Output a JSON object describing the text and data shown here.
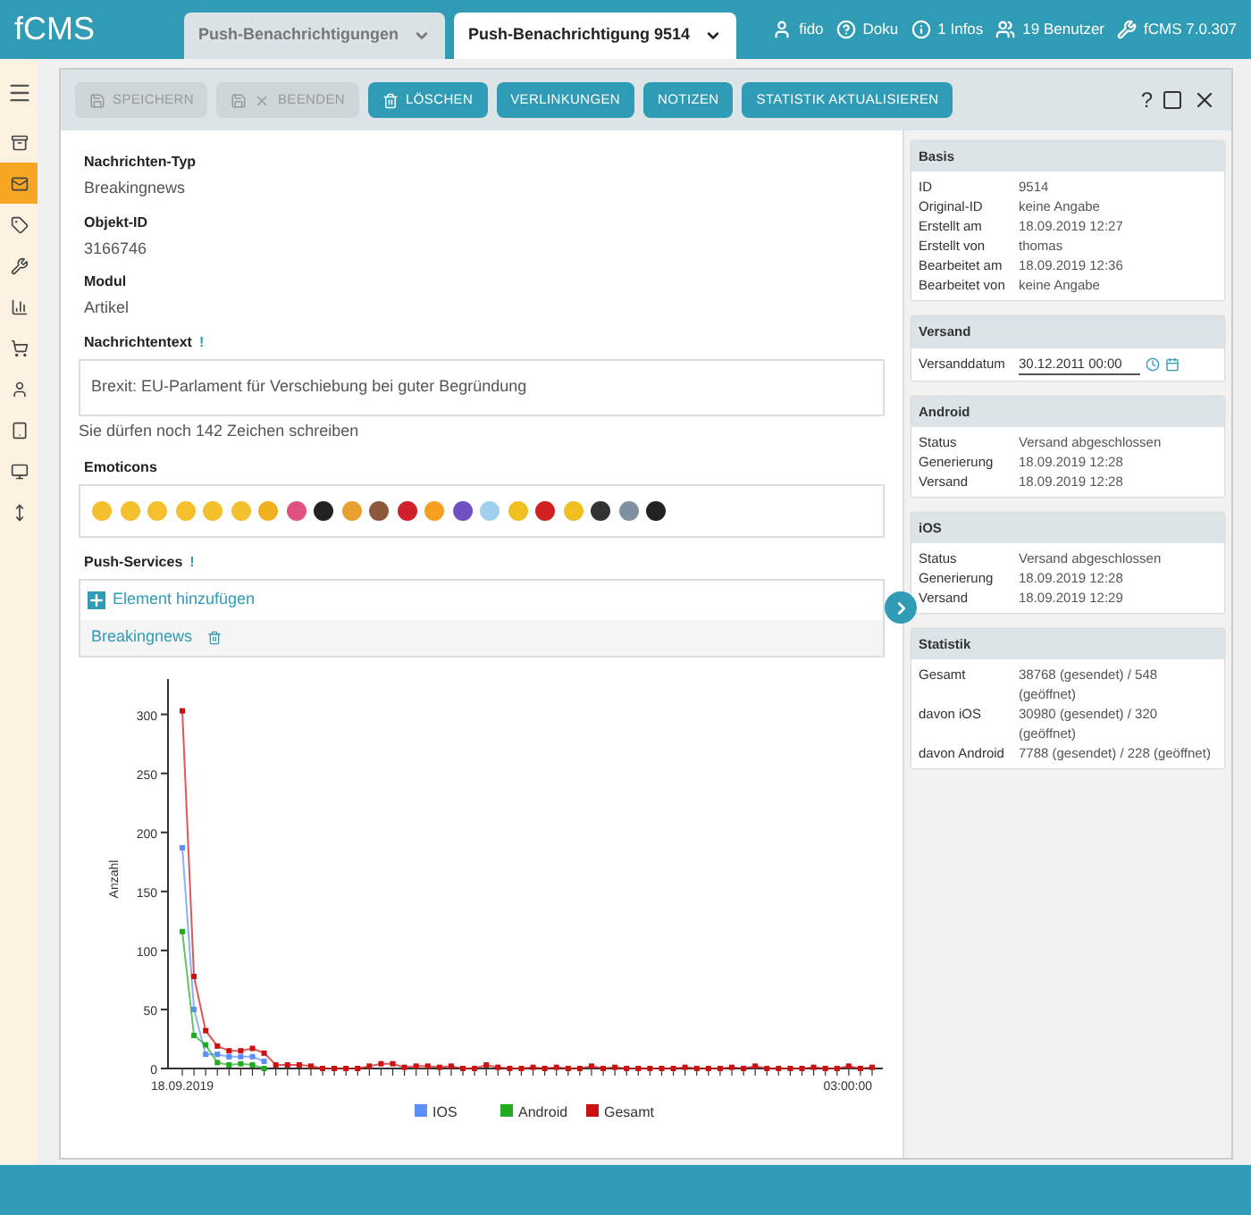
{
  "app": {
    "logo": "fCMS"
  },
  "tabs": [
    {
      "label": "Push-Benachrichtigungen",
      "selected": false
    },
    {
      "label": "Push-Benachrichtigung 9514",
      "selected": true
    }
  ],
  "header_links": [
    {
      "kind": "user",
      "label": "fido"
    },
    {
      "kind": "help",
      "label": "Doku"
    },
    {
      "kind": "info",
      "label": "1 Infos"
    },
    {
      "kind": "users",
      "label": "19 Benutzer"
    },
    {
      "kind": "version",
      "label": "fCMS 7.0.307"
    }
  ],
  "sidebar": {
    "items": [
      {
        "selected": false
      },
      {
        "selected": true
      },
      {
        "selected": false
      },
      {
        "selected": false
      },
      {
        "selected": false
      },
      {
        "selected": false
      },
      {
        "selected": false
      },
      {
        "selected": false
      },
      {
        "selected": false
      },
      {
        "selected": false
      }
    ]
  },
  "toolbar": [
    {
      "kind": "save",
      "label": "SPEICHERN",
      "disabled": true
    },
    {
      "kind": "close",
      "label": "BEENDEN",
      "disabled": true
    },
    {
      "kind": "delete",
      "label": "LÖSCHEN",
      "disabled": false
    },
    {
      "kind": "plain",
      "label": "VERLINKUNGEN",
      "disabled": false
    },
    {
      "kind": "plain",
      "label": "NOTIZEN",
      "disabled": false
    },
    {
      "kind": "plain",
      "label": "STATISTIK AKTUALISIEREN",
      "disabled": false
    }
  ],
  "window_controls": {
    "help": "?"
  },
  "fields": [
    {
      "label": "Nachrichten-Typ",
      "value": "Breakingnews"
    },
    {
      "label": "Objekt-ID",
      "value": "3166746"
    },
    {
      "label": "Modul",
      "value": "Artikel"
    }
  ],
  "message": {
    "label": "Nachrichtentext",
    "required_mark": "!",
    "value": "Brexit: EU-Parlament für Verschiebung bei guter Begründung",
    "hint": "Sie dürfen noch 142 Zeichen schreiben"
  },
  "emoticons": {
    "label": "Emoticons"
  },
  "push_services": {
    "label": "Push-Services",
    "required_mark": "!",
    "add": "Element hinzufügen",
    "items": [
      {
        "label": "Breakingnews"
      }
    ]
  },
  "chart_x_labels": [
    "18.09.2019",
    "03:00:00"
  ],
  "chart_data": {
    "type": "line",
    "legend": "bottom",
    "ylabel": "Anzahl",
    "ylim": [
      0,
      330
    ],
    "yticks": [
      0,
      50,
      100,
      150,
      200,
      250,
      300
    ],
    "series": [
      {
        "name": "IOS",
        "color": "#5b8ff9",
        "marker": "square",
        "values": [
          187,
          50,
          12,
          12,
          10,
          10,
          10,
          6,
          null,
          null,
          null,
          null,
          null,
          null,
          null,
          null,
          null,
          null,
          null,
          null,
          null,
          null,
          null,
          null,
          null,
          null,
          null,
          null,
          null,
          null,
          null,
          null,
          null,
          null,
          null,
          null,
          null,
          null,
          null,
          null,
          null,
          null,
          null,
          null,
          null,
          null,
          null,
          null,
          null,
          null,
          null,
          null,
          null,
          null,
          null,
          null,
          null,
          null,
          null,
          null
        ]
      },
      {
        "name": "Android",
        "color": "#22aa22",
        "marker": "square",
        "values": [
          116,
          28,
          20,
          5,
          3,
          4,
          3,
          0,
          null,
          null,
          null,
          null,
          null,
          null,
          null,
          null,
          null,
          null,
          null,
          null,
          null,
          null,
          null,
          null,
          null,
          null,
          null,
          null,
          null,
          null,
          null,
          null,
          null,
          null,
          null,
          null,
          null,
          null,
          null,
          null,
          null,
          null,
          null,
          null,
          null,
          null,
          null,
          null,
          null,
          null,
          null,
          null,
          null,
          null,
          null,
          null,
          null,
          null,
          null,
          null
        ]
      },
      {
        "name": "Gesamt",
        "color": "#cc1111",
        "marker": "square",
        "values": [
          303,
          78,
          32,
          19,
          15,
          15,
          17,
          13,
          3,
          3,
          3,
          2,
          0,
          0,
          0,
          0,
          2,
          4,
          4,
          1,
          2,
          2,
          1,
          2,
          0,
          0,
          3,
          1,
          0,
          0,
          1,
          0,
          1,
          0,
          0,
          2,
          0,
          1,
          0,
          0,
          0,
          0,
          0,
          1,
          0,
          0,
          0,
          1,
          0,
          2,
          0,
          0,
          0,
          0,
          1,
          0,
          0,
          2,
          0,
          1
        ]
      }
    ]
  },
  "info_panels": [
    {
      "kind": "table",
      "title": "Basis",
      "rows": [
        {
          "label": "ID",
          "value": "9514"
        },
        {
          "label": "Original-ID",
          "value": "keine Angabe"
        },
        {
          "label": "Erstellt am",
          "value": "18.09.2019 12:27"
        },
        {
          "label": "Erstellt von",
          "value": "thomas"
        },
        {
          "label": "Bearbeitet am",
          "value": "18.09.2019 12:36"
        },
        {
          "label": "Bearbeitet von",
          "value": "keine Angabe"
        }
      ]
    },
    {
      "kind": "date",
      "title": "Versand",
      "rows": [
        {
          "label": "Versanddatum",
          "value": "30.12.2011 00:00"
        }
      ]
    },
    {
      "kind": "table",
      "title": "Android",
      "rows": [
        {
          "label": "Status",
          "value": "Versand abgeschlossen"
        },
        {
          "label": "Generierung",
          "value": "18.09.2019 12:28"
        },
        {
          "label": "Versand",
          "value": "18.09.2019 12:28"
        }
      ]
    },
    {
      "kind": "table",
      "title": "iOS",
      "rows": [
        {
          "label": "Status",
          "value": "Versand abgeschlossen"
        },
        {
          "label": "Generierung",
          "value": "18.09.2019 12:28"
        },
        {
          "label": "Versand",
          "value": "18.09.2019 12:29"
        }
      ]
    },
    {
      "kind": "table",
      "title": "Statistik",
      "rows": [
        {
          "label": "Gesamt",
          "value": "38768 (gesendet) / 548 (geöffnet)"
        },
        {
          "label": "davon iOS",
          "value": "30980 (gesendet) / 320 (geöffnet)"
        },
        {
          "label": "davon Android",
          "value": "7788 (gesendet) / 228 (geöffnet)"
        }
      ]
    }
  ]
}
